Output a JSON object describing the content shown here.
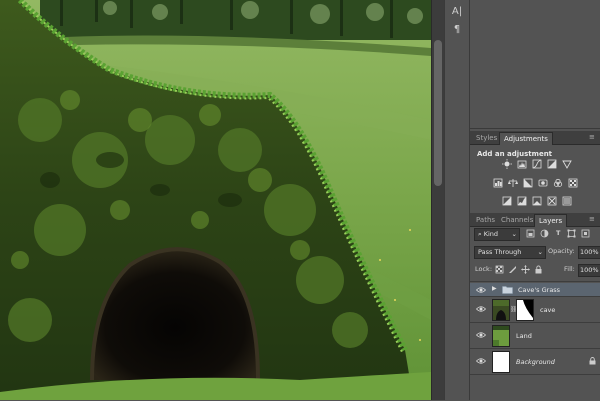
{
  "dock": {
    "buttons": [
      {
        "name": "character-panel-icon",
        "glyph": "A|"
      },
      {
        "name": "paragraph-panel-icon",
        "glyph": "¶"
      }
    ]
  },
  "panels": {
    "adjustments_group": {
      "tabs": [
        "Styles",
        "Adjustments"
      ],
      "active_tab": "Adjustments",
      "title": "Add an adjustment"
    },
    "layers_group": {
      "tabs": [
        "Paths",
        "Channels",
        "Layers"
      ],
      "active_tab": "Layers",
      "filter_kind": "Kind",
      "blend_mode": "Pass Through",
      "opacity_label": "Opacity:",
      "opacity_value": "100%",
      "lock_label": "Lock:",
      "fill_label": "Fill:",
      "fill_value": "100%",
      "layers": [
        {
          "name": "Cave's Grass",
          "type": "group",
          "selected": true,
          "expanded": false
        },
        {
          "name": "cave",
          "type": "layer-with-mask"
        },
        {
          "name": "Land",
          "type": "layer"
        },
        {
          "name": "Background",
          "type": "background",
          "locked": true,
          "italic": true
        }
      ]
    }
  },
  "colors": {
    "panel_bg": "#535353",
    "tab_bar": "#3f3f3f",
    "selected_row": "#5b6570",
    "grass": "#6d9c3e"
  }
}
